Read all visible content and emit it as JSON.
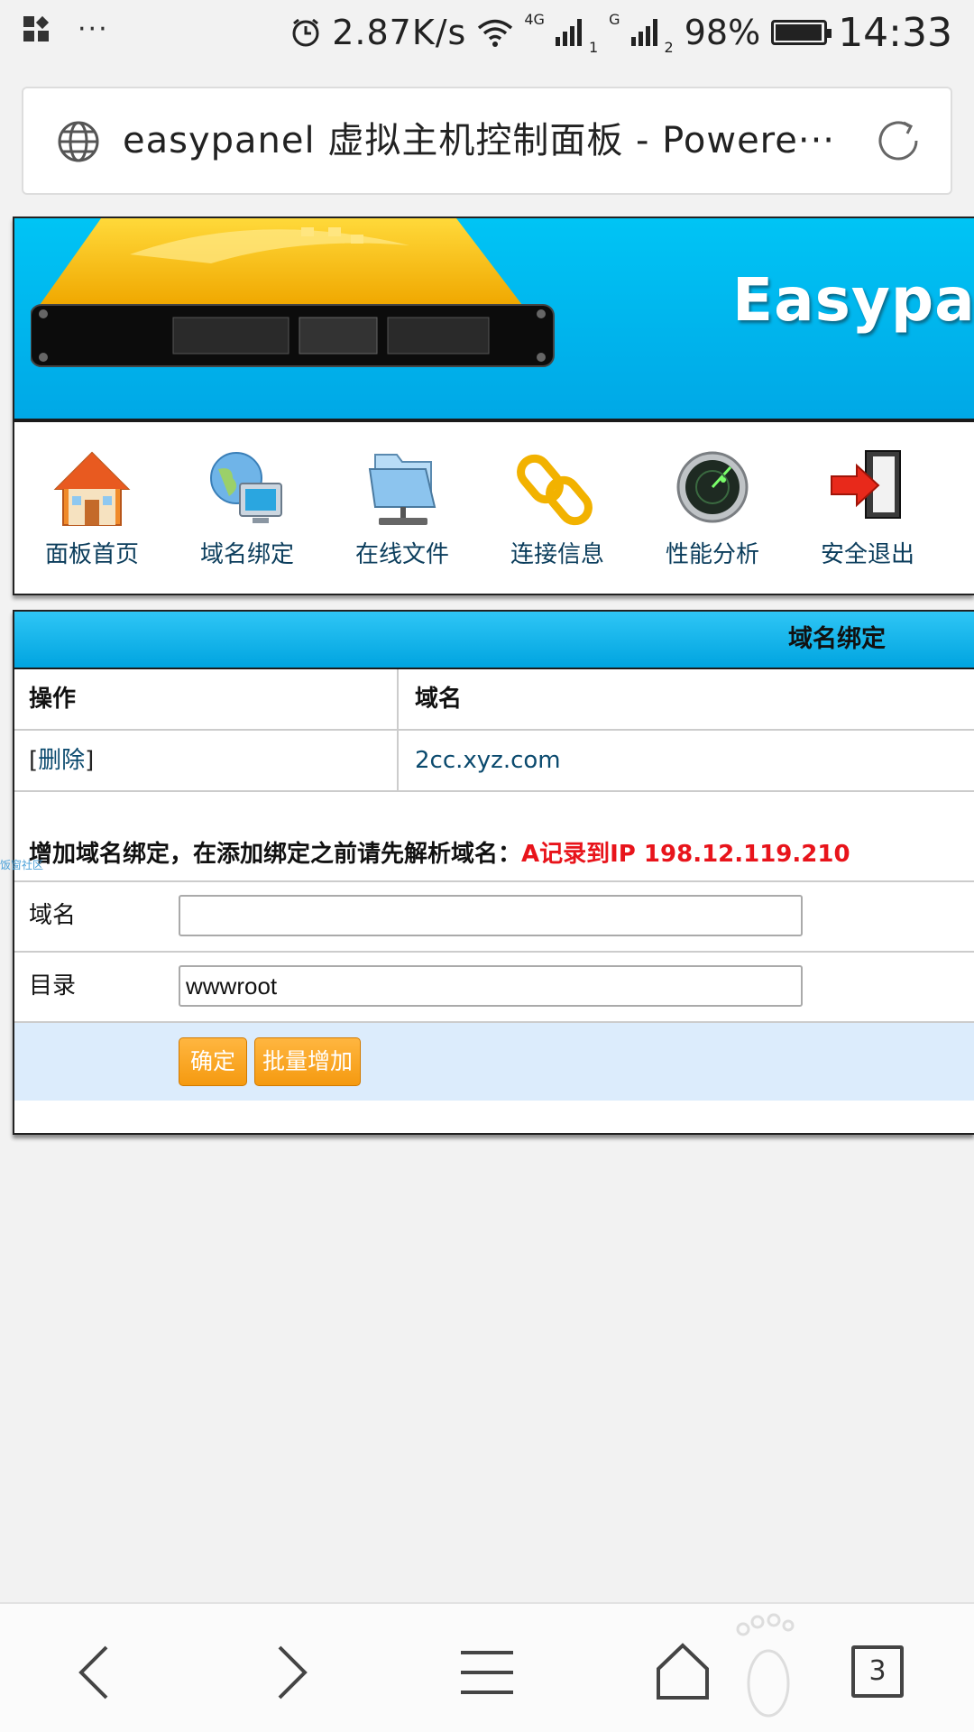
{
  "status_bar": {
    "net_speed": "2.87K/s",
    "sim1_type": "4G",
    "sim1_slot": "1",
    "sim2_type": "G",
    "sim2_slot": "2",
    "battery": "98%",
    "battery_level": 0.98,
    "time": "14:33"
  },
  "browser": {
    "page_title": "easypanel 虚拟主机控制面板 - Powere···",
    "tab_count": "3"
  },
  "banner": {
    "logo_text": "Easypanel"
  },
  "nav": {
    "items": [
      {
        "label": "面板首页",
        "icon": "home-icon"
      },
      {
        "label": "域名绑定",
        "icon": "globe-monitor-icon"
      },
      {
        "label": "在线文件",
        "icon": "folder-network-icon"
      },
      {
        "label": "连接信息",
        "icon": "chain-link-icon"
      },
      {
        "label": "性能分析",
        "icon": "radar-gauge-icon"
      },
      {
        "label": "安全退出",
        "icon": "exit-door-icon"
      }
    ]
  },
  "panel": {
    "title": "域名绑定",
    "table": {
      "headers": [
        "操作",
        "域名"
      ],
      "rows": [
        {
          "action": "删除",
          "domain": "2cc.xyz.com"
        }
      ]
    },
    "notice": "增加域名绑定，在添加绑定之前请先解析域名：",
    "notice_highlight": "A记录到IP 198.12.119.210",
    "form": {
      "domain_label": "域名",
      "domain_value": "",
      "dir_label": "目录",
      "dir_value": "wwwroot"
    },
    "buttons": {
      "confirm": "确定",
      "batch_add": "批量增加"
    }
  },
  "watermark": "饭窗社区",
  "colors": {
    "banner_blue": "#00b4ee",
    "link": "#0b4a6e",
    "alert_red": "#e8141b",
    "button_orange": "#f59a10",
    "button_row_bg": "#dcecfc"
  }
}
